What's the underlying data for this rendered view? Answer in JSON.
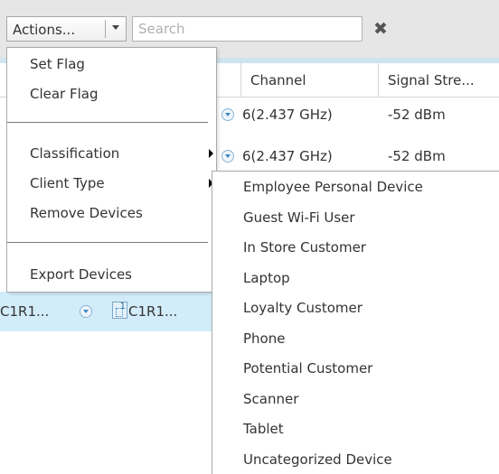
{
  "toolbar": {
    "actions_label": "Actions...",
    "search_placeholder": "Search",
    "search_value": "",
    "clear_icon": "close-icon"
  },
  "grid": {
    "columns": [
      "Channel",
      "Signal Stre..."
    ],
    "rows": [
      {
        "channel": "6(2.437 GHz)",
        "signal": "-52 dBm"
      },
      {
        "channel": "6(2.437 GHz)",
        "signal": "-52 dBm"
      }
    ],
    "selected_row": {
      "cell_1": "C1R1...",
      "cell_2": "C1R1..."
    },
    "selected_row_bg": "#d2ecfa"
  },
  "actions_menu": {
    "items": [
      {
        "label": "Set Flag"
      },
      {
        "label": "Clear Flag"
      },
      {
        "label": "Classification"
      },
      {
        "label": "Client Type"
      },
      {
        "label": "Remove Devices"
      },
      {
        "label": "Export Devices"
      }
    ]
  },
  "client_type_submenu": {
    "items": [
      "Employee Personal Device",
      "Guest Wi-Fi User",
      "In Store Customer",
      "Laptop",
      "Loyalty Customer",
      "Phone",
      "Potential Customer",
      "Scanner",
      "Tablet",
      "Uncategorized Device"
    ]
  }
}
